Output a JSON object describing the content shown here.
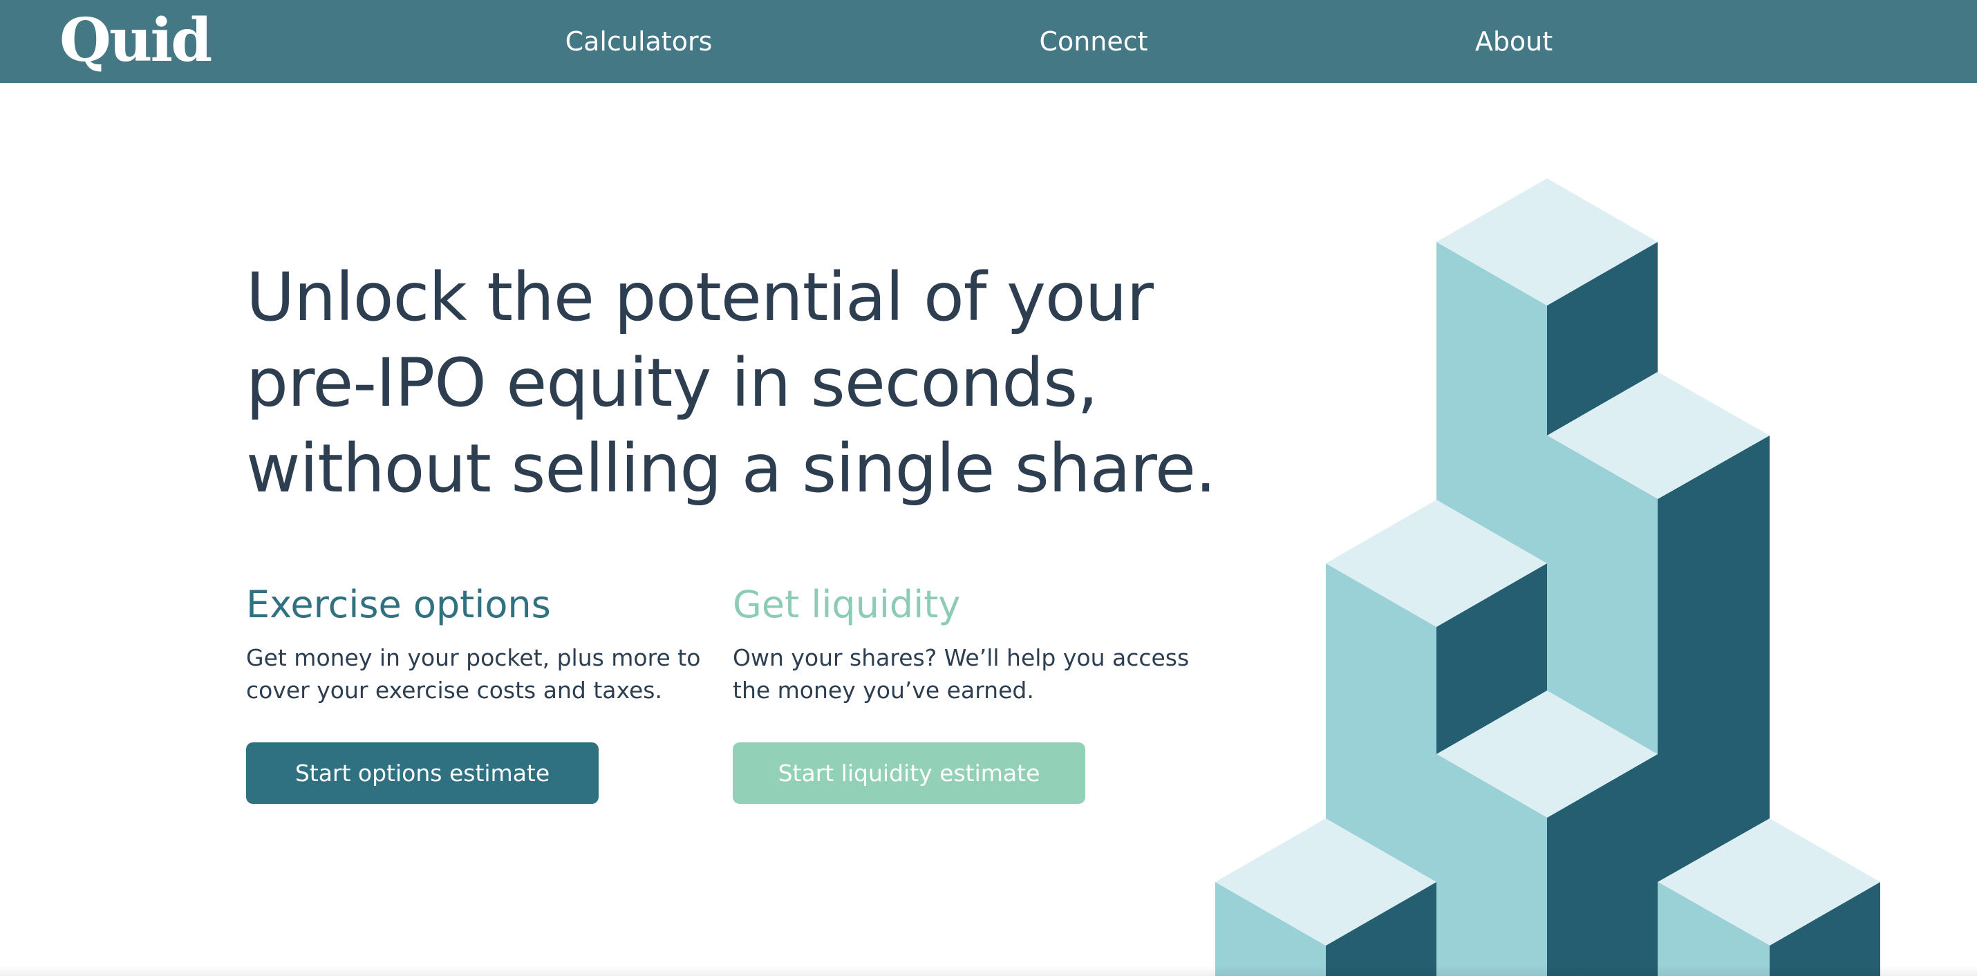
{
  "brand": {
    "logo": "Quid"
  },
  "nav": {
    "items": [
      {
        "label": "Calculators"
      },
      {
        "label": "Connect"
      },
      {
        "label": "About"
      }
    ]
  },
  "hero": {
    "lines": [
      "Unlock the potential of your",
      "pre-IPO equity in seconds,",
      "without selling a single share."
    ]
  },
  "options": {
    "title": "Exercise options",
    "text": "Get money in your pocket, plus more to cover your exercise costs and taxes.",
    "button": "Start options estimate"
  },
  "liquidity": {
    "title": "Get liquidity",
    "text": "Own your shares? We’ll help you access the money you’ve earned.",
    "button": "Start liquidity estimate"
  },
  "colors": {
    "nav_bg": "#457885",
    "headline": "#2c3e50",
    "options_accent": "#2f7180",
    "liquidity_accent": "#93d0b8",
    "cube_top": "#ddeff3",
    "cube_left": "#9ad1d7",
    "cube_right": "#245e70"
  }
}
